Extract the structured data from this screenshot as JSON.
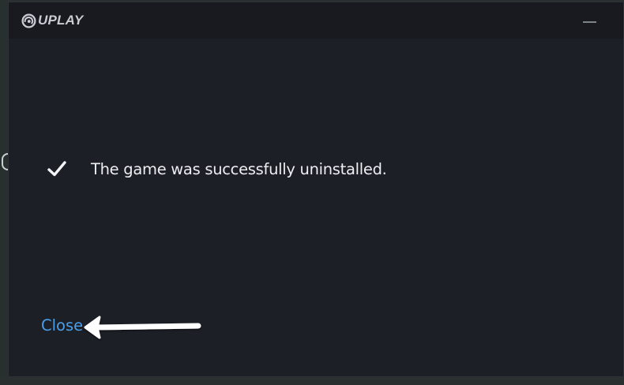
{
  "app": {
    "logo_text": "UPLAY",
    "logo_icon": "uplay-swirl-icon"
  },
  "titlebar": {
    "minimize_icon": "minimize-icon"
  },
  "message": {
    "icon": "checkmark-icon",
    "text": "The game was successfully uninstalled."
  },
  "actions": {
    "close_label": "Close"
  },
  "annotation": {
    "icon": "arrow-left-icon"
  },
  "colors": {
    "window_bg": "#1c1f26",
    "titlebar_bg": "#181a20",
    "link": "#4a9fe8",
    "text": "#eceef1"
  }
}
